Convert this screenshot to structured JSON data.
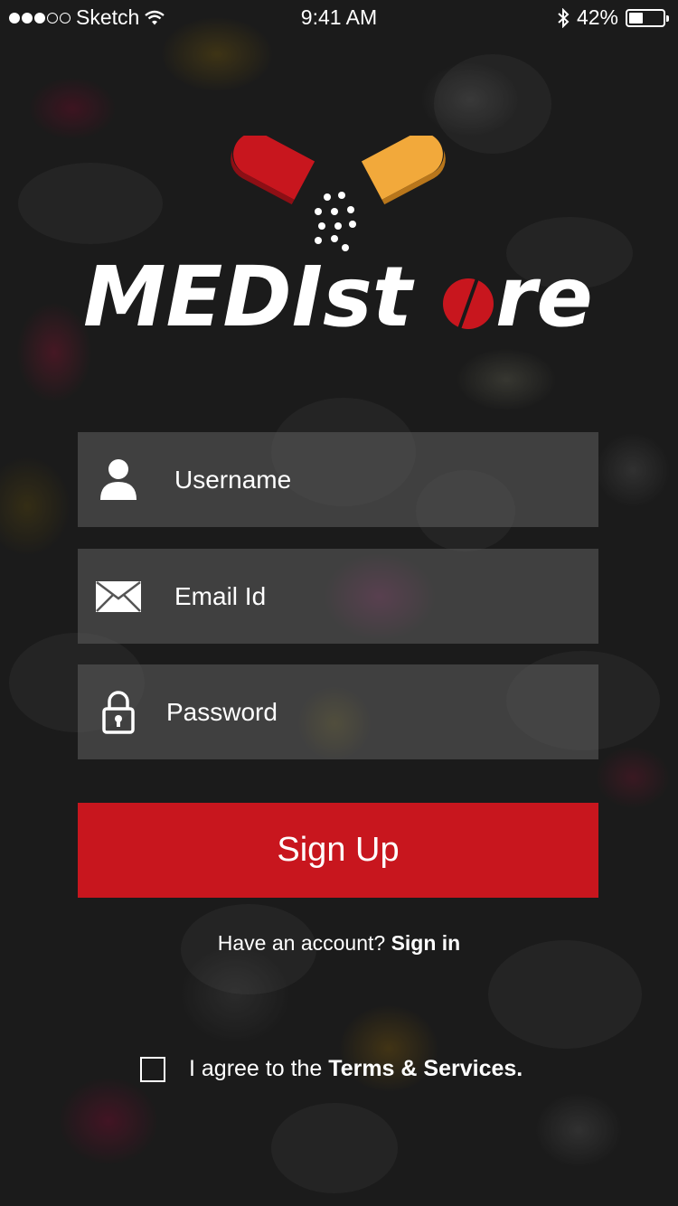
{
  "status_bar": {
    "carrier": "Sketch",
    "time": "9:41 AM",
    "battery": "42%",
    "battery_level": 0.42,
    "signal_dots_filled": 3,
    "signal_dots_total": 5
  },
  "logo": {
    "text_main": "MEDIst",
    "text_end": "re",
    "colors": {
      "red": "#c8161e",
      "yellow": "#f2a93b"
    }
  },
  "form": {
    "username_placeholder": "Username",
    "email_placeholder": "Email Id",
    "password_placeholder": "Password",
    "signup_label": "Sign Up"
  },
  "account": {
    "prompt": "Have an account?",
    "signin_label": "Sign in"
  },
  "terms": {
    "prefix": "I agree to the",
    "link": "Terms & Services.",
    "checked": false
  },
  "colors": {
    "accent": "#c8161e",
    "field_bg": "rgba(95,95,95,0.55)"
  }
}
